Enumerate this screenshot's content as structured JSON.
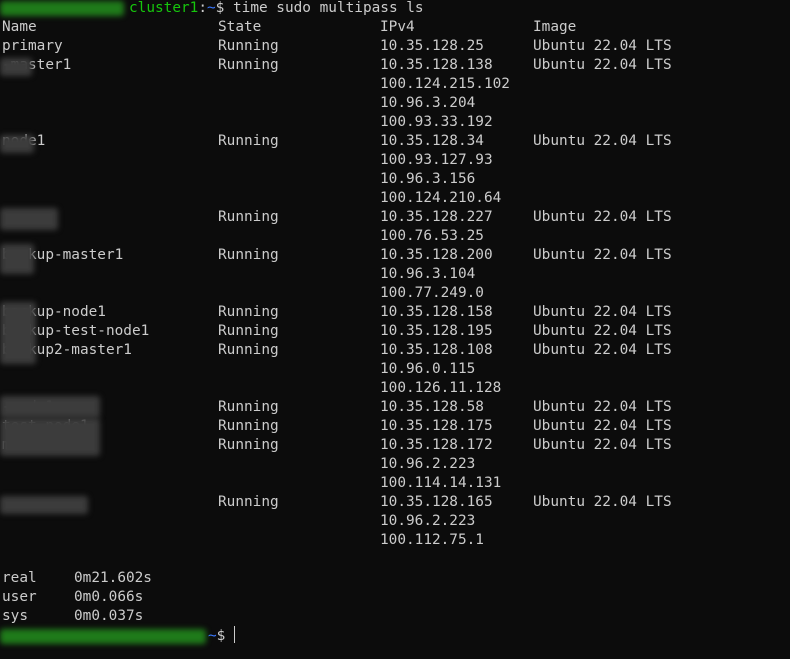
{
  "prompt": {
    "host": "cluster1",
    "separator": ":",
    "path": "~",
    "symbol": "$",
    "command": " time sudo multipass ls"
  },
  "table": {
    "headers": [
      "Name",
      "State",
      "IPv4",
      "Image"
    ],
    "rows": [
      {
        "name": "primary",
        "state": "Running",
        "ipv4": "10.35.128.25",
        "image": "Ubuntu 22.04 LTS"
      },
      {
        "name": "-master1",
        "state": "Running",
        "ipv4": "10.35.128.138",
        "image": "Ubuntu 22.04 LTS"
      },
      {
        "name": "",
        "state": "",
        "ipv4": "100.124.215.102",
        "image": ""
      },
      {
        "name": "",
        "state": "",
        "ipv4": "10.96.3.204",
        "image": ""
      },
      {
        "name": "",
        "state": "",
        "ipv4": "100.93.33.192",
        "image": ""
      },
      {
        "name": "node1",
        "state": "Running",
        "ipv4": "10.35.128.34",
        "image": "Ubuntu 22.04 LTS"
      },
      {
        "name": "",
        "state": "",
        "ipv4": "100.93.127.93",
        "image": ""
      },
      {
        "name": "",
        "state": "",
        "ipv4": "10.96.3.156",
        "image": ""
      },
      {
        "name": "",
        "state": "",
        "ipv4": "100.124.210.64",
        "image": ""
      },
      {
        "name": "",
        "state": "Running",
        "ipv4": "10.35.128.227",
        "image": "Ubuntu 22.04 LTS"
      },
      {
        "name": "",
        "state": "",
        "ipv4": "100.76.53.25",
        "image": ""
      },
      {
        "name": "backup-master1",
        "state": "Running",
        "ipv4": "10.35.128.200",
        "image": "Ubuntu 22.04 LTS"
      },
      {
        "name": "",
        "state": "",
        "ipv4": "10.96.3.104",
        "image": ""
      },
      {
        "name": "",
        "state": "",
        "ipv4": "100.77.249.0",
        "image": ""
      },
      {
        "name": "backup-node1",
        "state": "Running",
        "ipv4": "10.35.128.158",
        "image": "Ubuntu 22.04 LTS"
      },
      {
        "name": "backup-test-node1",
        "state": "Running",
        "ipv4": "10.35.128.195",
        "image": "Ubuntu 22.04 LTS"
      },
      {
        "name": "backup2-master1",
        "state": "Running",
        "ipv4": "10.35.128.108",
        "image": "Ubuntu 22.04 LTS"
      },
      {
        "name": "",
        "state": "",
        "ipv4": "10.96.0.115",
        "image": ""
      },
      {
        "name": "",
        "state": "",
        "ipv4": "100.126.11.128",
        "image": ""
      },
      {
        "name": "-node1",
        "state": "Running",
        "ipv4": "10.35.128.58",
        "image": "Ubuntu 22.04 LTS"
      },
      {
        "name": "test-node1",
        "state": "Running",
        "ipv4": "10.35.128.175",
        "image": "Ubuntu 22.04 LTS"
      },
      {
        "name": "master1",
        "state": "Running",
        "ipv4": "10.35.128.172",
        "image": "Ubuntu 22.04 LTS"
      },
      {
        "name": "",
        "state": "",
        "ipv4": "10.96.2.223",
        "image": ""
      },
      {
        "name": "",
        "state": "",
        "ipv4": "100.114.14.131",
        "image": ""
      },
      {
        "name": "",
        "state": "Running",
        "ipv4": "10.35.128.165",
        "image": "Ubuntu 22.04 LTS"
      },
      {
        "name": "",
        "state": "",
        "ipv4": "10.96.2.223",
        "image": ""
      },
      {
        "name": "",
        "state": "",
        "ipv4": "100.112.75.1",
        "image": ""
      }
    ]
  },
  "timing": [
    {
      "label": "real",
      "value": "0m21.602s"
    },
    {
      "label": "user",
      "value": "0m0.066s"
    },
    {
      "label": "sys",
      "value": "0m0.037s"
    }
  ],
  "final_prompt": {
    "path": "~",
    "symbol": "$ "
  },
  "colors": {
    "background": "#0c0c0c",
    "foreground": "#cccccc",
    "host": "#16c60c",
    "path": "#3b78ff"
  }
}
